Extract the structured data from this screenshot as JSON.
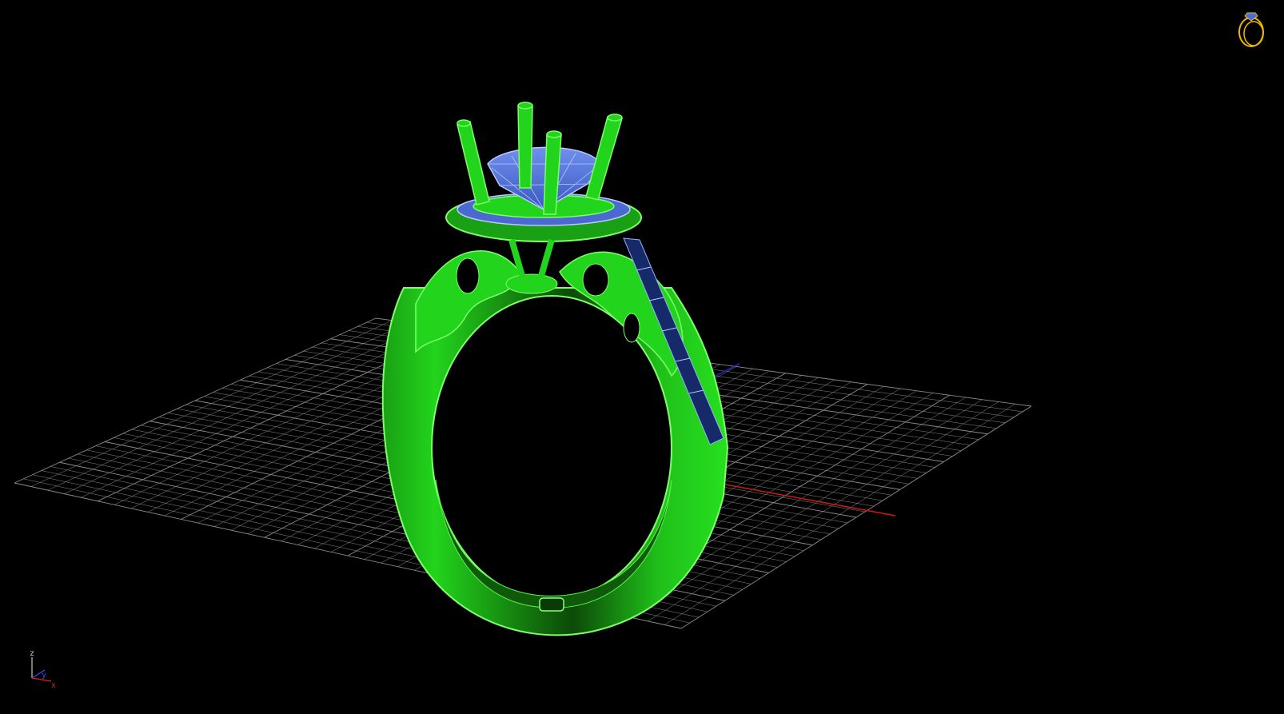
{
  "viewport": {
    "background": "#000000",
    "grid_color": "#8a8a8a",
    "model_color": "#22d41c",
    "model_edge_color": "#7dff6a",
    "gem_color": "#5878d8",
    "gem_edge_color": "#b7c8ff",
    "x_axis_color": "#d01818",
    "y_axis_color": "#2030d0"
  },
  "axis_triad": {
    "z_label": "z",
    "y_label": "y",
    "x_label": "x",
    "z_color": "#c8c8c8",
    "y_color": "#3a4cff",
    "x_color": "#e02020"
  },
  "view_cube": {
    "icon": "ring-icon",
    "color": "#f0b800",
    "gem_color": "#4a6ee0"
  }
}
